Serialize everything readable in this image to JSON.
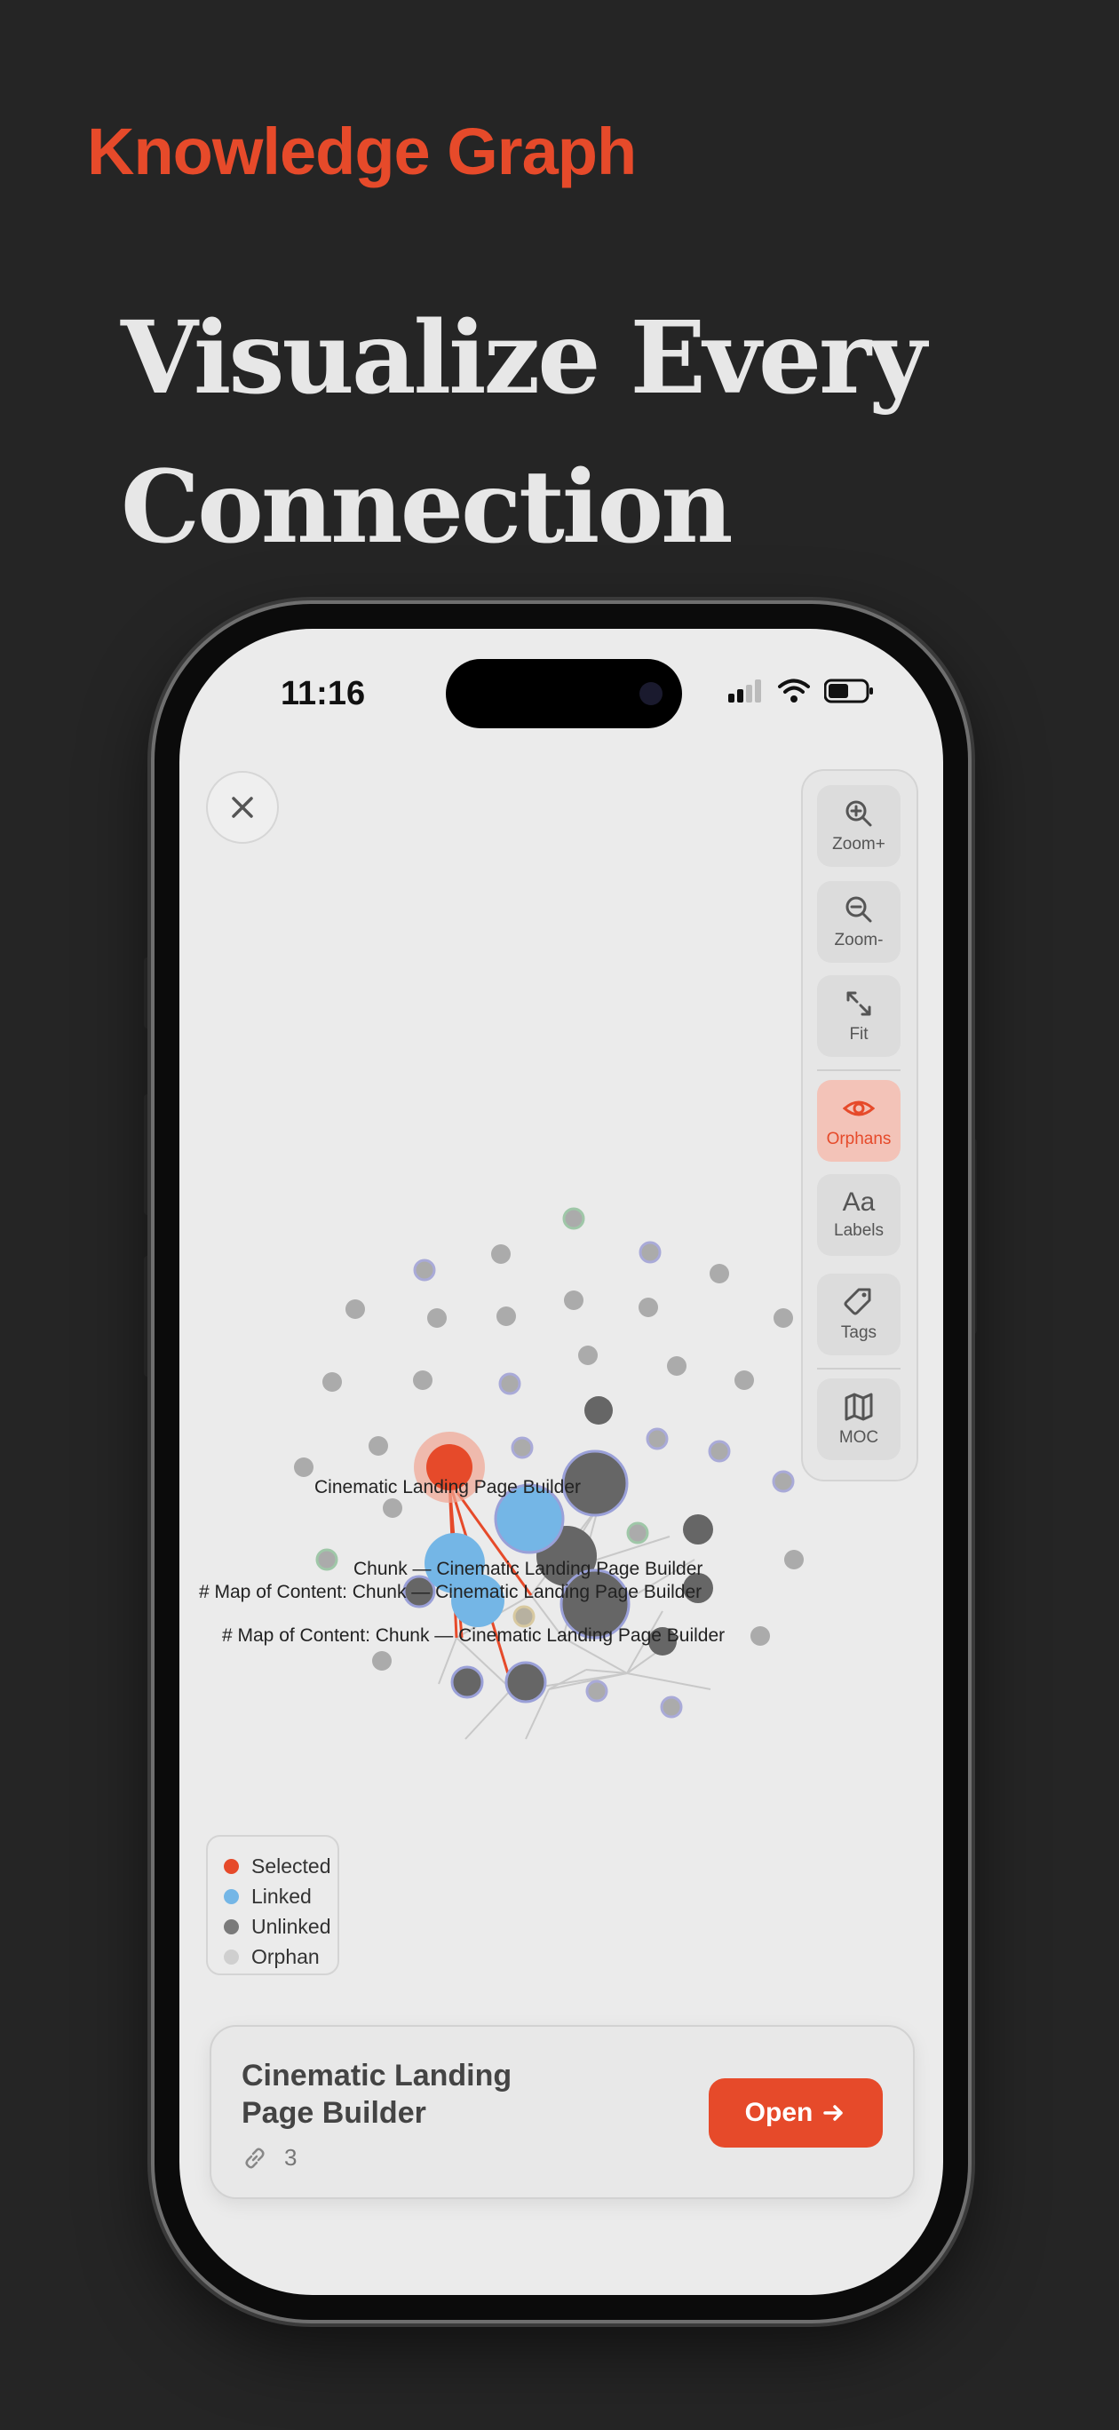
{
  "brand": "Knowledge Graph",
  "headline": [
    "Visualize Every",
    "Connection"
  ],
  "status": {
    "time": "11:16"
  },
  "toolbar": {
    "zoom_in": "Zoom+",
    "zoom_out": "Zoom-",
    "fit": "Fit",
    "orphans": "Orphans",
    "labels_glyph": "Aa",
    "labels": "Labels",
    "tags": "Tags",
    "moc": "MOC"
  },
  "graph": {
    "labels": [
      "Cinematic Landing Page Builder",
      "Chunk — Cinematic Landing Page Builder",
      "# Map of Content: Chunk — Cinematic Landing Page Builder",
      "# Map of Content: Chunk — Cinematic Landing Page Builder"
    ]
  },
  "legend": [
    {
      "label": "Selected",
      "color": "#e64a2a"
    },
    {
      "label": "Linked",
      "color": "#74b6e6"
    },
    {
      "label": "Unlinked",
      "color": "#7a7a7a"
    },
    {
      "label": "Orphan",
      "color": "#cfcfcf"
    }
  ],
  "card": {
    "title": "Cinematic Landing Page Builder",
    "link_count": "3",
    "open_label": "Open"
  },
  "colors": {
    "accent": "#e64a2a",
    "linked": "#74b6e6",
    "unlinked": "#666666",
    "orphan": "#ababab"
  }
}
